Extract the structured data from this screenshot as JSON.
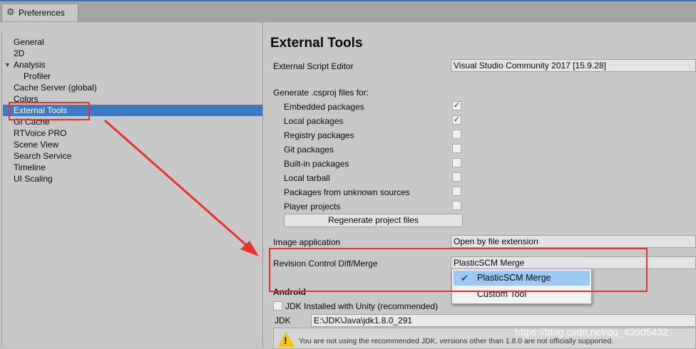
{
  "window": {
    "tab_title": "Preferences",
    "icon": "gear-icon"
  },
  "sidebar": {
    "items": [
      {
        "label": "General"
      },
      {
        "label": "2D"
      },
      {
        "label": "Analysis",
        "expanded": true
      },
      {
        "label": "Profiler"
      },
      {
        "label": "Cache Server (global)"
      },
      {
        "label": "Colors"
      },
      {
        "label": "External Tools",
        "selected": true
      },
      {
        "label": "GI Cache"
      },
      {
        "label": "RTVoice PRO"
      },
      {
        "label": "Scene View"
      },
      {
        "label": "Search Service"
      },
      {
        "label": "Timeline"
      },
      {
        "label": "UI Scaling"
      }
    ]
  },
  "main": {
    "title": "External Tools",
    "script_editor": {
      "label": "External Script Editor",
      "value": "Visual Studio Community 2017 [15.9.28]"
    },
    "csproj_header": "Generate .csproj files for:",
    "csproj_options": [
      {
        "label": "Embedded packages",
        "checked": true
      },
      {
        "label": "Local packages",
        "checked": true
      },
      {
        "label": "Registry packages",
        "checked": false
      },
      {
        "label": "Git packages",
        "checked": false
      },
      {
        "label": "Built-in packages",
        "checked": false
      },
      {
        "label": "Local tarball",
        "checked": false
      },
      {
        "label": "Packages from unknown sources",
        "checked": false
      },
      {
        "label": "Player projects",
        "checked": false
      }
    ],
    "regenerate_button": "Regenerate project files",
    "image_app": {
      "label": "Image application",
      "value": "Open by file extension"
    },
    "diff_merge": {
      "label": "Revision Control Diff/Merge",
      "value": "PlasticSCM Merge"
    },
    "diff_merge_options": [
      {
        "label": "PlasticSCM Merge",
        "selected": true
      },
      {
        "label": "Custom Tool",
        "selected": false
      }
    ],
    "android": {
      "header": "Android",
      "jdk_checkbox": "JDK Installed with Unity (recommended)",
      "jdk_label": "JDK",
      "jdk_path": "E:\\JDK\\Java\\jdk1.8.0_291",
      "warning": "You are not using the recommended JDK, versions other than 1.8.0 are not officially supported."
    }
  },
  "watermark": "https://blog.csdn.net/qq_43505432",
  "colors": {
    "selection": "#3e7ac2",
    "annotation": "#e8322f",
    "popup_selected": "#9cc8f2"
  }
}
